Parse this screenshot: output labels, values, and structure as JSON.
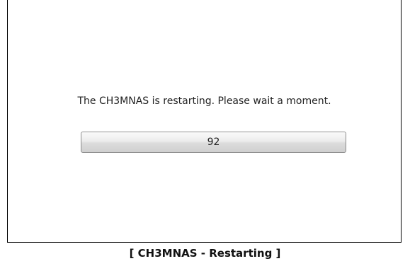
{
  "dialog": {
    "message": "The CH3MNAS is restarting. Please wait a moment.",
    "countdown": "92"
  },
  "caption": "[ CH3MNAS - Restarting ]"
}
